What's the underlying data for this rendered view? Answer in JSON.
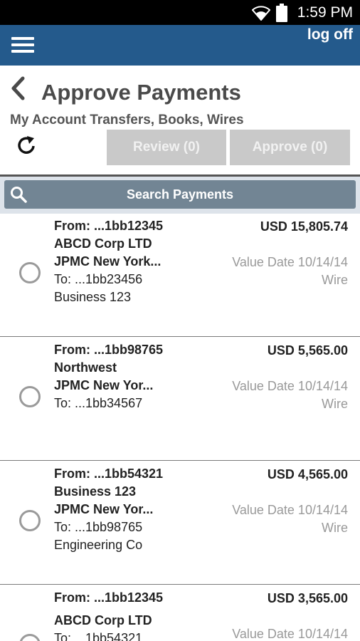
{
  "status_bar": {
    "time": "1:59 PM",
    "icons": [
      "wifi-icon",
      "battery-icon"
    ]
  },
  "app_bar": {
    "menu_icon": "hamburger-menu-icon",
    "logoff_label": "log off"
  },
  "header": {
    "back_icon": "chevron-left-icon",
    "title": "Approve Payments",
    "subtitle": "My Account Transfers, Books, Wires"
  },
  "actions": {
    "refresh_icon": "refresh-icon",
    "review_label": "Review (0)",
    "approve_label": "Approve (0)"
  },
  "search": {
    "icon": "search-icon",
    "label": "Search Payments"
  },
  "payments": [
    {
      "from": "From: ...1bb12345",
      "from_name": "ABCD Corp LTD",
      "bank": "JPMC New York...",
      "to": "To: ...1bb23456",
      "to_name": "Business 123",
      "amount": "USD 15,805.74",
      "value_date": "Value Date 10/14/14",
      "type": "Wire"
    },
    {
      "from": "From: ...1bb98765",
      "from_name": "Northwest",
      "bank": "JPMC New Yor...",
      "to": "To: ...1bb34567",
      "to_name": "",
      "amount": "USD 5,565.00",
      "value_date": "Value Date 10/14/14",
      "type": "Wire"
    },
    {
      "from": "From: ...1bb54321",
      "from_name": "Business 123",
      "bank": "JPMC New Yor...",
      "to": "To: ...1bb98765",
      "to_name": "Engineering Co",
      "amount": "USD 4,565.00",
      "value_date": "Value Date 10/14/14",
      "type": "Wire"
    },
    {
      "from": "From: ...1bb12345",
      "from_name": "ABCD Corp LTD",
      "bank": "",
      "to": "To: ...1bb54321",
      "to_name": "",
      "amount": "USD 3,565.00",
      "value_date": "Value Date 10/14/14",
      "type": ""
    }
  ],
  "colors": {
    "app_bar": "#245a8c",
    "search_bar": "#728594",
    "button_disabled": "#c9c9c9"
  }
}
